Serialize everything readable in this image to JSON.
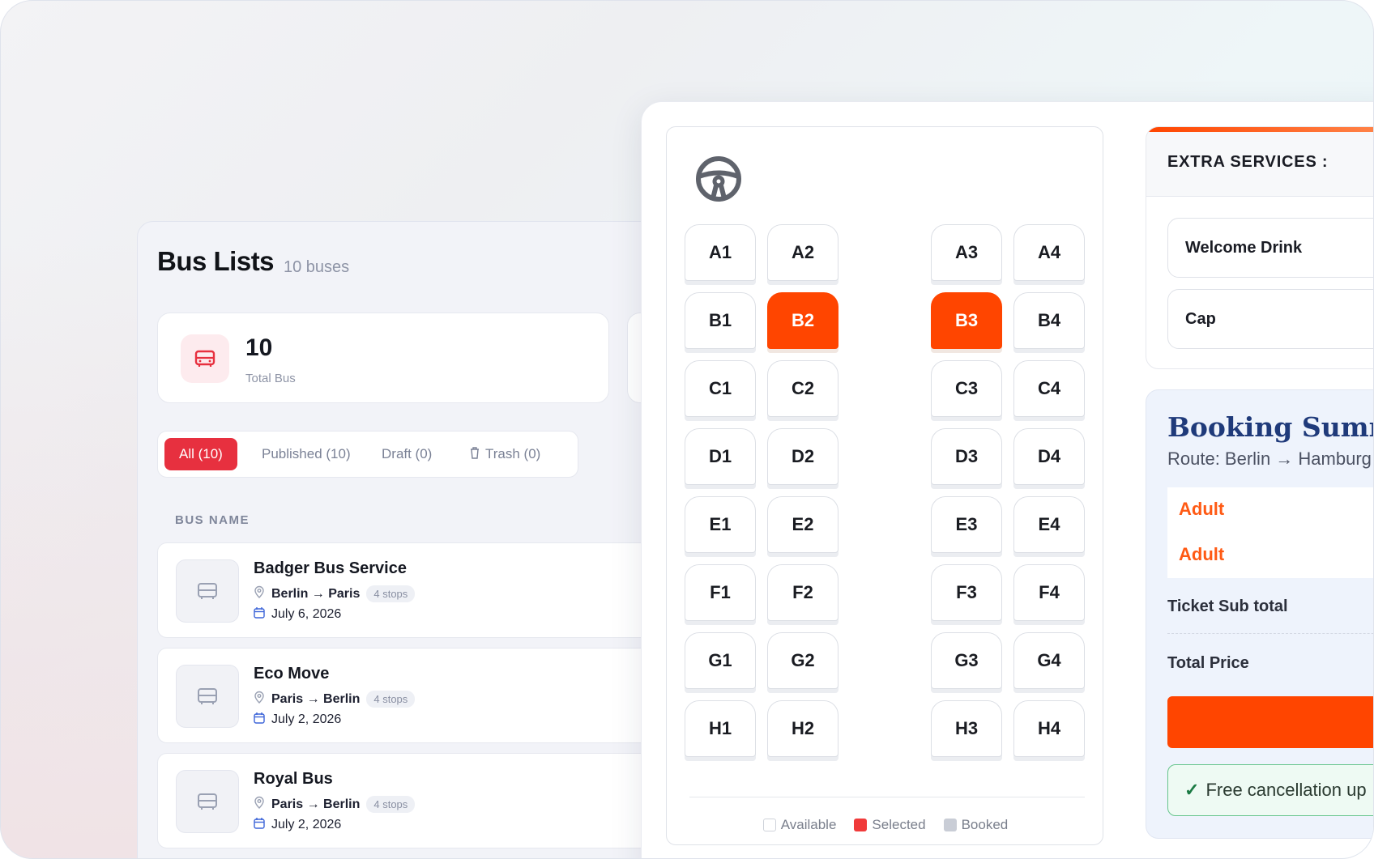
{
  "bus_list": {
    "title": "Bus Lists",
    "count": "10 buses",
    "stat": {
      "value": "10",
      "label": "Total Bus"
    },
    "tabs": [
      {
        "label": "All (10)"
      },
      {
        "label": "Published (10)"
      },
      {
        "label": "Draft (0)"
      },
      {
        "label": "Trash (0)"
      }
    ],
    "column_header": "BUS NAME",
    "rows": [
      {
        "name": "Badger Bus Service",
        "route": "Berlin → Paris",
        "stops": "4 stops",
        "date": "July 6, 2026"
      },
      {
        "name": "Eco Move",
        "route": "Paris → Berlin",
        "stops": "4 stops",
        "date": "July 2, 2026"
      },
      {
        "name": "Royal Bus",
        "route": "Paris → Berlin",
        "stops": "4 stops",
        "date": "July 2, 2026"
      }
    ]
  },
  "seat_map": {
    "rows": [
      [
        "A1",
        "A2",
        "A3",
        "A4"
      ],
      [
        "B1",
        "B2",
        "B3",
        "B4"
      ],
      [
        "C1",
        "C2",
        "C3",
        "C4"
      ],
      [
        "D1",
        "D2",
        "D3",
        "D4"
      ],
      [
        "E1",
        "E2",
        "E3",
        "E4"
      ],
      [
        "F1",
        "F2",
        "F3",
        "F4"
      ],
      [
        "G1",
        "G2",
        "G3",
        "G4"
      ],
      [
        "H1",
        "H2",
        "H3",
        "H4"
      ]
    ],
    "selected": [
      "B2",
      "B3"
    ],
    "legend": {
      "available": "Available",
      "selected": "Selected",
      "booked": "Booked"
    },
    "colors": {
      "selected": "#ff4500",
      "available": "#ffffff",
      "booked": "#c9cdd6"
    }
  },
  "extras": {
    "title": "EXTRA SERVICES :",
    "items": [
      {
        "label": "Welcome Drink"
      },
      {
        "label": "Cap"
      }
    ]
  },
  "summary": {
    "title": "Booking Summar",
    "route": "Route: Berlin → Hamburg",
    "fares": [
      {
        "label": "Adult"
      },
      {
        "label": "Adult"
      }
    ],
    "subtotal_label": "Ticket Sub total",
    "total_label": "Total Price",
    "cancellation": "Free cancellation up"
  },
  "colors": {
    "accent": "#ff4500",
    "tab_active": "#e7303f",
    "summary_title": "#1f3a7a"
  }
}
